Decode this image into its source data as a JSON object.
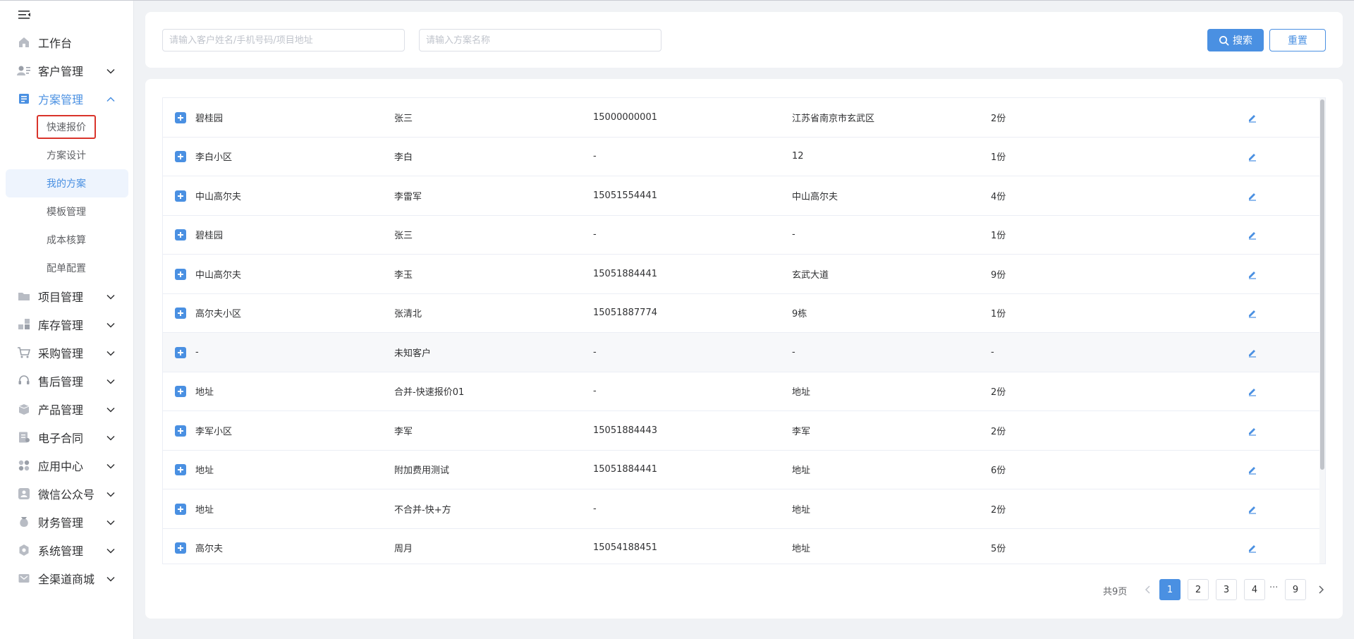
{
  "sidebar": {
    "menu": [
      {
        "label": "工作台",
        "icon": "home-icon",
        "has_chevron": false
      },
      {
        "label": "客户管理",
        "icon": "customer-icon",
        "has_chevron": true
      },
      {
        "label": "方案管理",
        "icon": "plan-icon",
        "has_chevron": true,
        "expanded": true,
        "active": true,
        "children": [
          {
            "label": "快速报价",
            "highlighted": true
          },
          {
            "label": "方案设计"
          },
          {
            "label": "我的方案",
            "selected": true
          },
          {
            "label": "模板管理"
          },
          {
            "label": "成本核算"
          },
          {
            "label": "配单配置"
          }
        ]
      },
      {
        "label": "项目管理",
        "icon": "folder-icon",
        "has_chevron": true
      },
      {
        "label": "库存管理",
        "icon": "inventory-icon",
        "has_chevron": true
      },
      {
        "label": "采购管理",
        "icon": "cart-icon",
        "has_chevron": true
      },
      {
        "label": "售后管理",
        "icon": "headset-icon",
        "has_chevron": true
      },
      {
        "label": "产品管理",
        "icon": "box-icon",
        "has_chevron": true
      },
      {
        "label": "电子合同",
        "icon": "contract-icon",
        "has_chevron": true
      },
      {
        "label": "应用中心",
        "icon": "apps-icon",
        "has_chevron": true
      },
      {
        "label": "微信公众号",
        "icon": "wechat-icon",
        "has_chevron": true
      },
      {
        "label": "财务管理",
        "icon": "finance-icon",
        "has_chevron": true
      },
      {
        "label": "系统管理",
        "icon": "settings-icon",
        "has_chevron": true
      },
      {
        "label": "全渠道商城",
        "icon": "mall-icon",
        "has_chevron": true
      }
    ]
  },
  "search": {
    "customer_value": "",
    "customer_placeholder": "请输入客户姓名/手机号码/项目地址",
    "plan_value": "",
    "plan_placeholder": "请输入方案名称",
    "search_label": "搜索",
    "reset_label": "重置"
  },
  "table": {
    "rows": [
      {
        "project": "碧桂园",
        "customer": "张三",
        "phone": "15000000001",
        "address": "江苏省南京市玄武区",
        "count": "2份"
      },
      {
        "project": "李白小区",
        "customer": "李白",
        "phone": "-",
        "address": "12",
        "count": "1份"
      },
      {
        "project": "中山高尔夫",
        "customer": "李雷军",
        "phone": "15051554441",
        "address": "中山高尔夫",
        "count": "4份"
      },
      {
        "project": "碧桂园",
        "customer": "张三",
        "phone": "-",
        "address": "-",
        "count": "1份"
      },
      {
        "project": "中山高尔夫",
        "customer": "李玉",
        "phone": "15051884441",
        "address": "玄武大道",
        "count": "9份"
      },
      {
        "project": "高尔夫小区",
        "customer": "张清北",
        "phone": "15051887774",
        "address": "9栋",
        "count": "1份"
      },
      {
        "project": "-",
        "customer": "未知客户",
        "phone": "-",
        "address": "-",
        "count": "-",
        "hover": true
      },
      {
        "project": "地址",
        "customer": "合并-快速报价01",
        "phone": "-",
        "address": "地址",
        "count": "2份"
      },
      {
        "project": "李军小区",
        "customer": "李军",
        "phone": "15051884443",
        "address": "李军",
        "count": "2份"
      },
      {
        "project": "地址",
        "customer": "附加费用测试",
        "phone": "15051884441",
        "address": "地址",
        "count": "6份"
      },
      {
        "project": "地址",
        "customer": "不合并-快+方",
        "phone": "-",
        "address": "地址",
        "count": "2份"
      },
      {
        "project": "高尔夫",
        "customer": "周月",
        "phone": "15054188451",
        "address": "地址",
        "count": "5份"
      }
    ]
  },
  "pagination": {
    "total_text": "共9页",
    "pages": [
      "1",
      "2",
      "3",
      "4"
    ],
    "ellipsis": "···",
    "last_page": "9",
    "current": "1"
  },
  "colors": {
    "accent": "#4a90e2",
    "highlight_border": "#d9342b"
  }
}
